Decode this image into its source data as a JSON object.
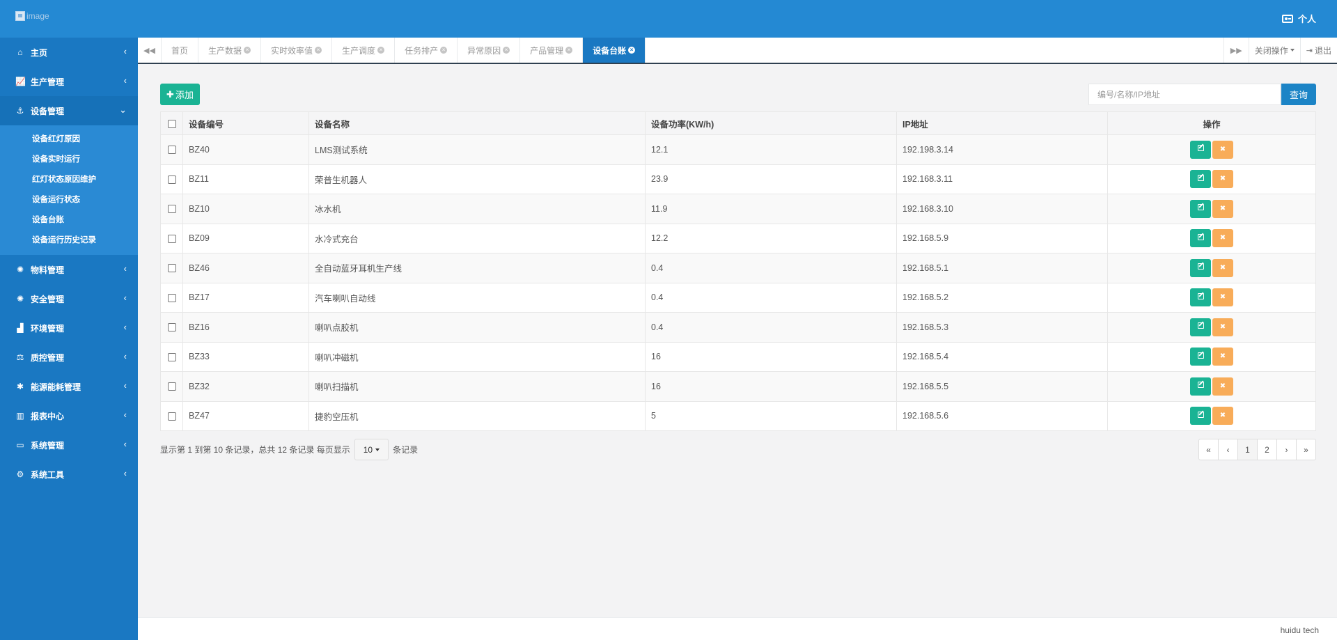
{
  "header": {
    "logo_alt": "image",
    "user_label": "个人"
  },
  "sidebar": {
    "items": [
      {
        "label": "主页",
        "icon": "home-icon",
        "glyph": "⌂"
      },
      {
        "label": "生产管理",
        "icon": "line-chart-icon",
        "glyph": "📈"
      },
      {
        "label": "设备管理",
        "icon": "anchor-icon",
        "glyph": "⚓",
        "open": true
      },
      {
        "label": "物料管理",
        "icon": "bug-icon",
        "glyph": "✺"
      },
      {
        "label": "安全管理",
        "icon": "bug-icon",
        "glyph": "✺"
      },
      {
        "label": "环境管理",
        "icon": "area-chart-icon",
        "glyph": "▟"
      },
      {
        "label": "质控管理",
        "icon": "balance-scale-icon",
        "glyph": "⚖"
      },
      {
        "label": "能源能耗管理",
        "icon": "asterisk-icon",
        "glyph": "✱"
      },
      {
        "label": "报表中心",
        "icon": "bar-chart-icon",
        "glyph": "▥"
      },
      {
        "label": "系统管理",
        "icon": "desktop-icon",
        "glyph": "▭"
      },
      {
        "label": "系统工具",
        "icon": "gear-icon",
        "glyph": "⚙"
      }
    ],
    "submenu": [
      "设备红灯原因",
      "设备实时运行",
      "红灯状态原因维护",
      "设备运行状态",
      "设备台账",
      "设备运行历史记录"
    ]
  },
  "tabs": {
    "items": [
      "首页",
      "生产数据",
      "实时效率值",
      "生产调度",
      "任务排产",
      "异常原因",
      "产品管理",
      "设备台账"
    ],
    "active_index": 7,
    "close_ops": "关闭操作",
    "logout": "退出"
  },
  "toolbar": {
    "add_label": "添加",
    "search_placeholder": "编号/名称/IP地址",
    "search_button": "查询"
  },
  "table": {
    "headers": [
      "设备编号",
      "设备名称",
      "设备功率(KW/h)",
      "IP地址",
      "操作"
    ],
    "rows": [
      [
        "BZ40",
        "LMS测试系统",
        "12.1",
        "192.198.3.14"
      ],
      [
        "BZ11",
        "荣普生机器人",
        "23.9",
        "192.168.3.11"
      ],
      [
        "BZ10",
        "冰水机",
        "11.9",
        "192.168.3.10"
      ],
      [
        "BZ09",
        "水冷式充台",
        "12.2",
        "192.168.5.9"
      ],
      [
        "BZ46",
        "全自动蓝牙耳机生产线",
        "0.4",
        "192.168.5.1"
      ],
      [
        "BZ17",
        "汽车喇叭自动线",
        "0.4",
        "192.168.5.2"
      ],
      [
        "BZ16",
        "喇叭点胶机",
        "0.4",
        "192.168.5.3"
      ],
      [
        "BZ33",
        "喇叭冲磁机",
        "16",
        "192.168.5.4"
      ],
      [
        "BZ32",
        "喇叭扫描机",
        "16",
        "192.168.5.5"
      ],
      [
        "BZ47",
        "捷豹空压机",
        "5",
        "192.168.5.6"
      ]
    ]
  },
  "pager": {
    "info": "显示第 1 到第 10 条记录，总共 12 条记录 每页显示",
    "page_size": "10",
    "suffix": "条记录",
    "buttons": [
      "«",
      "‹",
      "1",
      "2",
      "›",
      "»"
    ],
    "active_page": "1"
  },
  "footer": {
    "text": "huidu tech"
  },
  "colors": {
    "header": "#2489d3",
    "sidebar": "#1a78c2",
    "primary_green": "#1ab394",
    "warning_orange": "#f8ac59",
    "search_blue": "#1c84c6"
  }
}
